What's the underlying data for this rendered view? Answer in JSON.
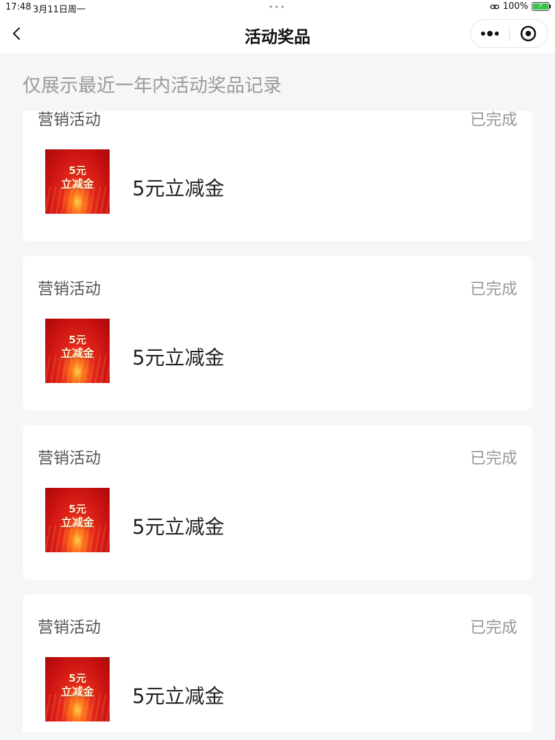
{
  "status_bar": {
    "time": "17:48",
    "date": "3月11日周一",
    "battery": "100%",
    "icons": [
      "link-icon",
      "battery-charging-icon"
    ]
  },
  "nav": {
    "title": "活动奖品",
    "icons": [
      "back-chevron-icon",
      "more-dots-icon",
      "close-target-icon"
    ]
  },
  "notice": "仅展示最近一年内活动奖品记录",
  "records": [
    {
      "activity": "营销活动",
      "status": "已完成",
      "prize_image_amount": "5元",
      "prize_image_name": "立减金",
      "prize_name": "5元立减金"
    },
    {
      "activity": "营销活动",
      "status": "已完成",
      "prize_image_amount": "5元",
      "prize_image_name": "立减金",
      "prize_name": "5元立减金"
    },
    {
      "activity": "营销活动",
      "status": "已完成",
      "prize_image_amount": "5元",
      "prize_image_name": "立减金",
      "prize_name": "5元立减金"
    },
    {
      "activity": "营销活动",
      "status": "已完成",
      "prize_image_amount": "5元",
      "prize_image_name": "立减金",
      "prize_name": "5元立减金"
    }
  ],
  "colors": {
    "page_bg": "#f5f6f7",
    "card_bg": "#ffffff",
    "prize_red": "#d8181a",
    "muted_text": "#999999",
    "battery_green": "#36c24b"
  }
}
